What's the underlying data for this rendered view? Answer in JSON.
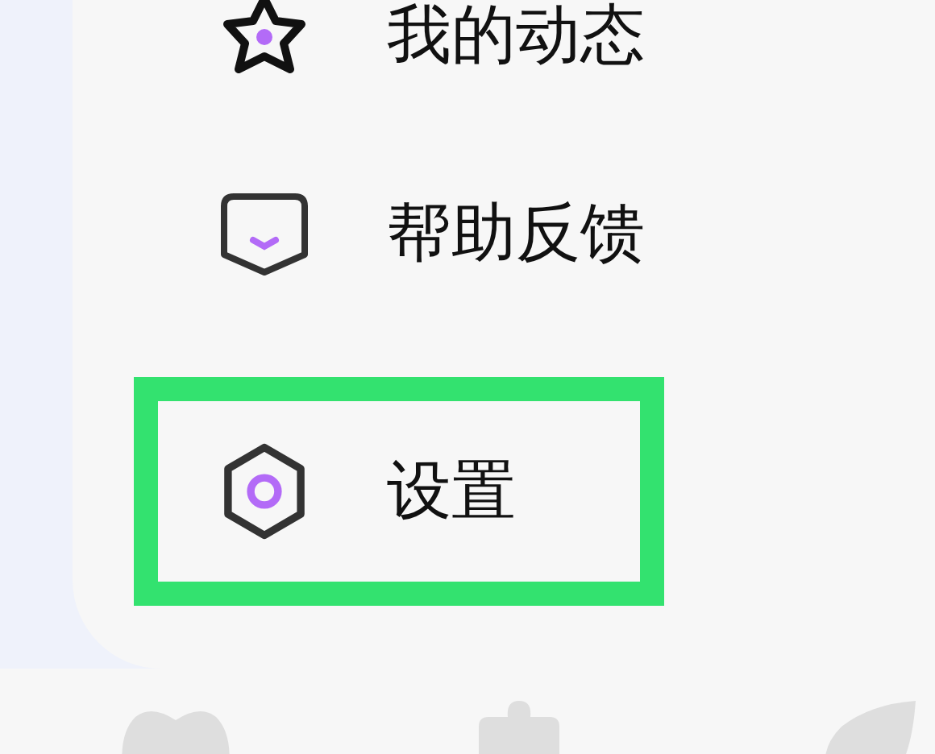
{
  "menu": {
    "items": [
      {
        "label": "我的动态",
        "kind": "star",
        "highlighted": false
      },
      {
        "label": "帮助反馈",
        "kind": "feedback",
        "highlighted": false
      },
      {
        "label": "设置",
        "kind": "settings",
        "highlighted": true
      }
    ]
  }
}
